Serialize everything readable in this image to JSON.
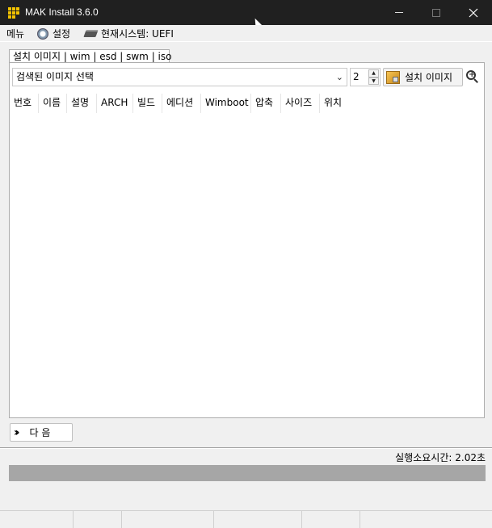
{
  "window": {
    "title": "MAK Install 3.6.0"
  },
  "menu": {
    "items": [
      {
        "label": "메뉴",
        "icon": ""
      },
      {
        "label": "설정",
        "icon": "gear-icon"
      },
      {
        "label": "현재시스템: UEFI",
        "icon": "chip-icon"
      }
    ]
  },
  "tab": {
    "label": "설치 이미지 | wim | esd | swm | iso"
  },
  "toolbar": {
    "combo_value": "검색된 이미지 선택",
    "spin_value": "2",
    "install_label": "설치 이미지"
  },
  "table": {
    "columns": [
      "번호",
      "이름",
      "설명",
      "ARCH",
      "빌드",
      "에디션",
      "Wimboot",
      "압축",
      "사이즈",
      "위치"
    ],
    "rows": []
  },
  "footer": {
    "next_label": "다 음",
    "elapsed": "실행소요시간: 2.02초",
    "progress": 0
  },
  "colors": {
    "titlebar": "#202020",
    "progress_track": "#a6a6a6"
  }
}
